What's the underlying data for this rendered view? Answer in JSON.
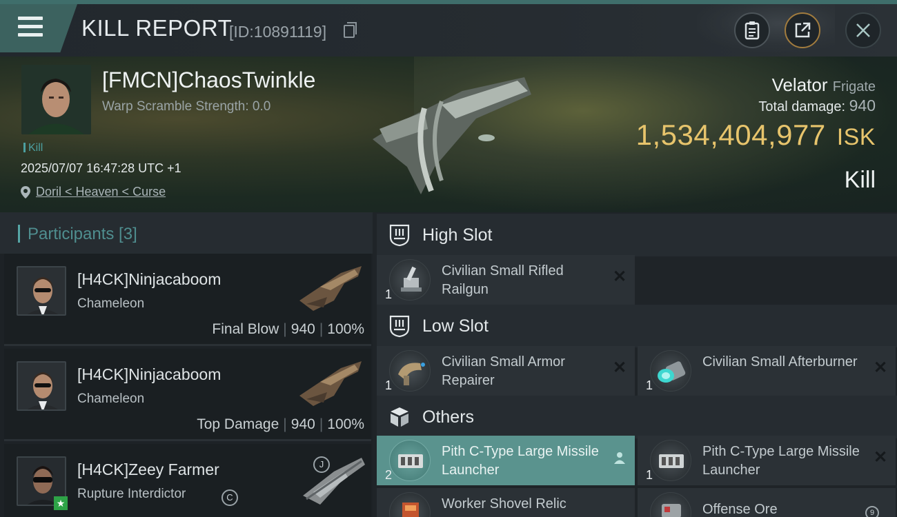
{
  "header": {
    "title": "KILL REPORT",
    "report_id": "[ID:10891119]",
    "icons": [
      "menu-icon",
      "copy-icon",
      "clipboard-icon",
      "share-icon",
      "close-icon"
    ]
  },
  "victim": {
    "name": "[FMCN]ChaosTwinkle",
    "warp_scramble": "Warp Scramble Strength: 0.0",
    "tag": "Kill",
    "datetime": "2025/07/07 16:47:28 UTC +1",
    "location": "Doril < Heaven < Curse",
    "ship_name": "Velator",
    "ship_class": "Frigate",
    "total_damage_label": "Total damage:",
    "total_damage": "940",
    "isk_value": "1,534,404,977",
    "isk_unit": "ISK",
    "result": "Kill"
  },
  "participants": {
    "title": "Participants [3]",
    "rows": [
      {
        "name": "[H4CK]Ninjacaboom",
        "ship": "Chameleon",
        "role": "Final Blow",
        "damage": "940",
        "percent": "100%"
      },
      {
        "name": "[H4CK]Ninjacaboom",
        "ship": "Chameleon",
        "role": "Top Damage",
        "damage": "940",
        "percent": "100%"
      },
      {
        "name": "[H4CK]Zeey Farmer",
        "ship": "Rupture Interdictor",
        "badge_ship": "C",
        "badge_img": "J"
      }
    ]
  },
  "fittings": {
    "high_slot": {
      "label": "High Slot",
      "items": [
        {
          "name": "Civilian Small Rifled Railgun",
          "qty": "1"
        }
      ]
    },
    "low_slot": {
      "label": "Low Slot",
      "items": [
        {
          "name": "Civilian Small Armor Repairer",
          "qty": "1"
        },
        {
          "name": "Civilian Small Afterburner",
          "qty": "1"
        }
      ]
    },
    "others": {
      "label": "Others",
      "items": [
        {
          "name": "Pith C-Type Large Missile Launcher",
          "qty": "2"
        },
        {
          "name": "Pith C-Type Large Missile Launcher",
          "qty": "1"
        },
        {
          "name": "Worker Shovel Relic",
          "qty": ""
        },
        {
          "name": "Offense Ore",
          "qty": "",
          "badge": "9"
        }
      ]
    }
  },
  "colors": {
    "accent": "#3c625f",
    "isk": "#e7c46c",
    "selected": "#5a938e"
  }
}
